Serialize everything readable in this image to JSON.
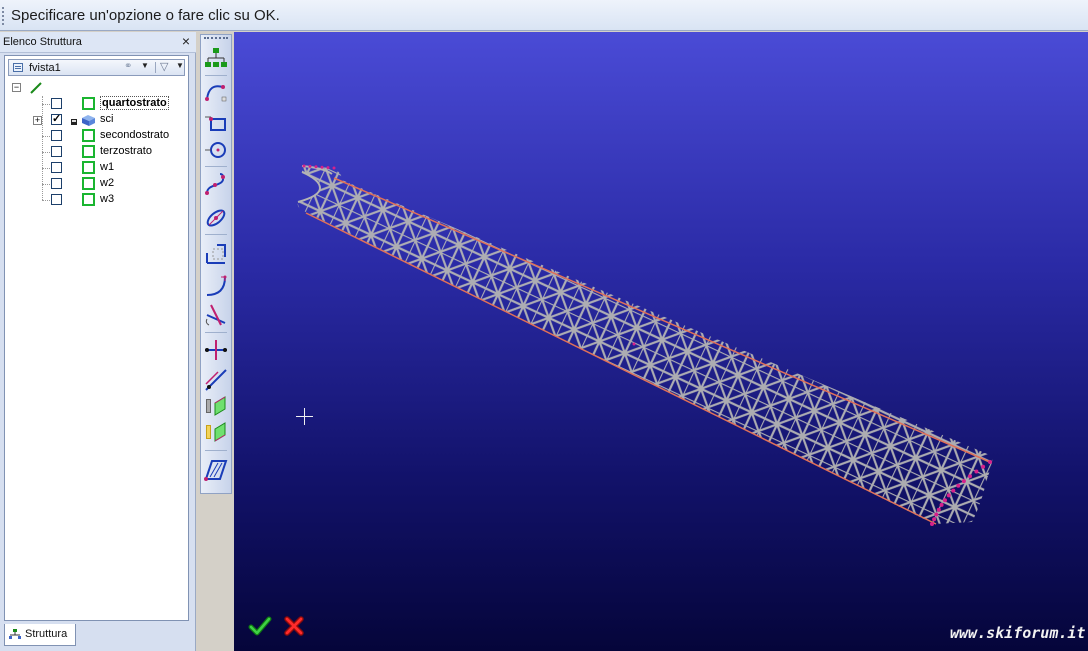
{
  "prompt": {
    "text": "Specificare un'opzione o fare clic su OK."
  },
  "structure_panel": {
    "title": "Elenco Struttura",
    "view_name": "fvista1",
    "tree": [
      {
        "label": "quartostrato",
        "checked": false,
        "active": true
      },
      {
        "label": "sci",
        "checked": true,
        "expandable": true
      },
      {
        "label": "secondostrato",
        "checked": false
      },
      {
        "label": "terzostrato",
        "checked": false
      },
      {
        "label": "w1",
        "checked": false
      },
      {
        "label": "w2",
        "checked": false
      },
      {
        "label": "w3",
        "checked": false
      }
    ],
    "tab_label": "Struttura"
  },
  "toolbar": {
    "buttons": [
      "structure-tree-icon",
      "arc-icon",
      "rectangle-icon",
      "circle-icon",
      "spline-icon",
      "ellipse-slot-icon",
      "corner-icon",
      "fillet-icon",
      "trim-icon",
      "intersect-icon",
      "line-icon",
      "extrude-icon",
      "surface-icon",
      "hatch-icon"
    ]
  },
  "viewport": {
    "watermark": "www.skiforum.it",
    "colors": {
      "mesh": "#b4b4b4",
      "outline": "#e07058",
      "edge_nodes": "#d6208c",
      "bg_top": "#4a4bd6",
      "bg_bottom": "#05053a"
    }
  },
  "actions": {
    "ok_label": "OK",
    "cancel_label": "Annulla"
  }
}
